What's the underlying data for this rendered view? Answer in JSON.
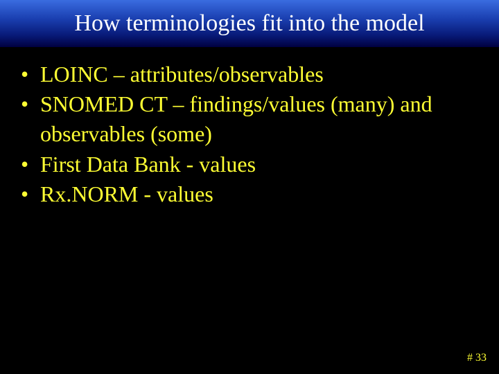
{
  "slide": {
    "title": "How terminologies fit into the model",
    "bullets": [
      "LOINC – attributes/observables",
      "SNOMED CT – findings/values (many) and observables (some)",
      "First Data Bank - values",
      "Rx.NORM - values"
    ],
    "footer": "# 33"
  }
}
